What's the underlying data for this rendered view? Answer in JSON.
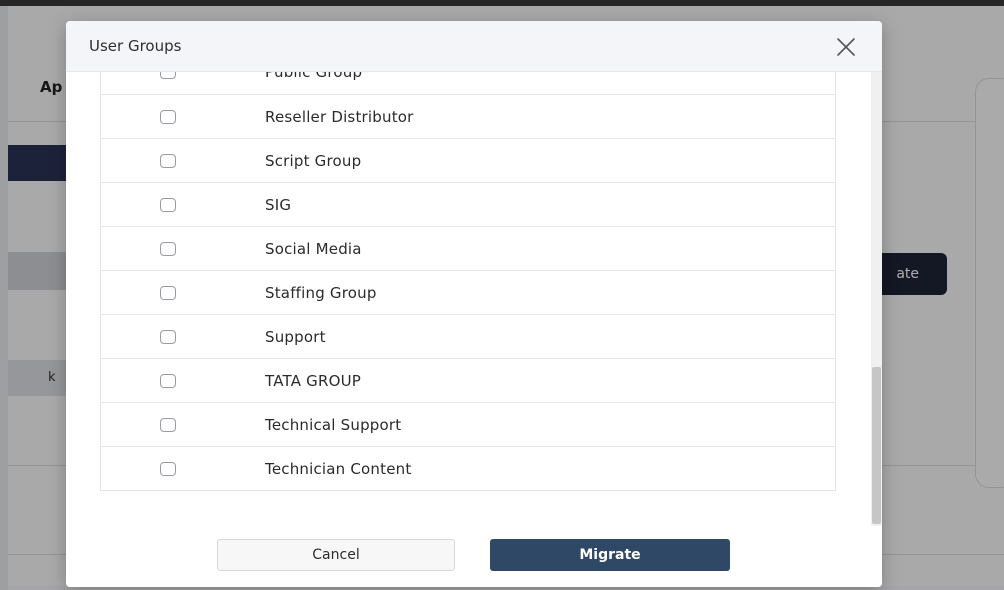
{
  "background": {
    "title": "Ap",
    "row_text": "k",
    "button_label": "ate"
  },
  "modal": {
    "title": "User Groups",
    "close_icon": "close-icon",
    "groups": [
      {
        "label": "Public Group",
        "checked": false
      },
      {
        "label": "Reseller Distributor",
        "checked": false
      },
      {
        "label": "Script Group",
        "checked": false
      },
      {
        "label": "SIG",
        "checked": false
      },
      {
        "label": "Social Media",
        "checked": false
      },
      {
        "label": "Staffing Group",
        "checked": false
      },
      {
        "label": "Support",
        "checked": false
      },
      {
        "label": "TATA GROUP",
        "checked": false
      },
      {
        "label": "Technical Support",
        "checked": false
      },
      {
        "label": "Technician Content",
        "checked": false
      }
    ],
    "cancel_label": "Cancel",
    "migrate_label": "Migrate"
  },
  "colors": {
    "primary": "#2f4865",
    "header_bg": "#f4f5f8",
    "overlay": "rgba(0,0,0,0.32)"
  }
}
